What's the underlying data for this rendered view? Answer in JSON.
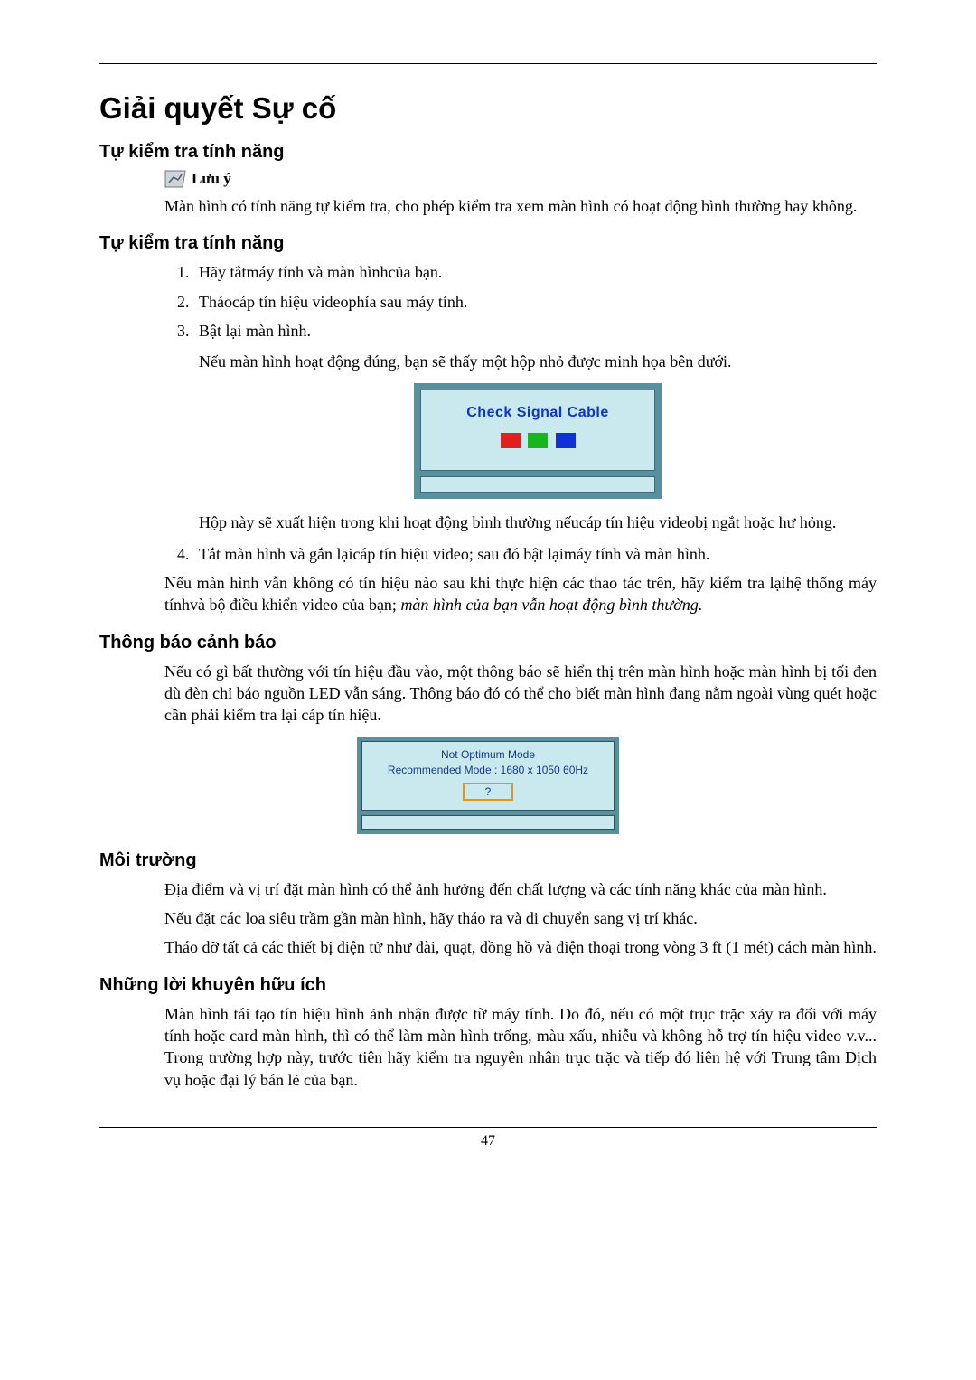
{
  "page_title": "Giải quyết Sự cố",
  "sections": {
    "s1_heading": "Tự kiểm tra tính năng",
    "note_label": "Lưu ý",
    "s1_body": "Màn hình có tính năng tự kiểm tra, cho phép kiểm tra xem màn hình có hoạt động bình thường hay không.",
    "s2_heading": "Tự kiểm tra tính năng",
    "steps": {
      "i1": "Hãy tắtmáy tính và màn hìnhcủa bạn.",
      "i2": "Tháocáp tín hiệu videophía sau máy tính.",
      "i3": "Bật lại màn hình.",
      "i3_sub": "Nếu màn hình hoạt động đúng, bạn sẽ thấy một hộp nhỏ được minh họa bên dưới.",
      "i3_sub2": "Hộp này sẽ xuất hiện trong khi hoạt động bình thường nếucáp tín hiệu videobị ngắt hoặc hư hỏng.",
      "i4": "Tắt màn hình và gắn lạicáp tín hiệu video; sau đó bật lạimáy tính và màn hình."
    },
    "s2_body_after_a": "Nếu màn hình vẫn không có tín hiệu nào sau khi thực hiện các thao tác trên, hãy kiểm tra lạihệ thống máy tínhvà bộ điều khiển video của bạn; ",
    "s2_body_after_italic": "màn hình của bạn vẫn hoạt động bình thường.",
    "s3_heading": "Thông báo cảnh báo",
    "s3_body": "Nếu có gì bất thường với tín hiệu đầu vào, một thông báo sẽ hiển thị trên màn hình hoặc màn hình bị tối đen dù đèn chỉ báo nguồn LED vẫn sáng. Thông báo đó có thể cho biết màn hình đang nằm ngoài vùng quét hoặc cần phải kiểm tra lại cáp tín hiệu.",
    "s4_heading": "Môi trường",
    "s4_p1": "Địa điểm và vị trí đặt màn hình có thể ảnh hưởng đến chất lượng và các tính năng khác của màn hình.",
    "s4_p2": "Nếu đặt các loa siêu trầm gần màn hình, hãy tháo ra và di chuyển sang vị trí khác.",
    "s4_p3": "Tháo dỡ tất cả các thiết bị điện tử như đài, quạt, đồng hồ và điện thoại trong vòng 3 ft (1 mét) cách màn hình.",
    "s5_heading": "Những lời khuyên hữu ích",
    "s5_body": "Màn hình tái tạo tín hiệu hình ảnh nhận được từ máy tính. Do đó, nếu có một trục trặc xảy ra đối với máy tính hoặc card màn hình, thì có thể làm màn hình trống, màu xấu, nhiễu và không hỗ trợ tín hiệu video v.v... Trong trường hợp này, trước tiên hãy kiểm tra nguyên nhân trục trặc và tiếp đó liên hệ với Trung tâm Dịch vụ hoặc đại lý bán lẻ của bạn."
  },
  "figures": {
    "check_signal_text": "Check Signal Cable",
    "optimum_line1": "Not Optimum Mode",
    "optimum_line2": "Recommended Mode : 1680 x 1050 60Hz",
    "optimum_button": "?"
  },
  "page_number": "47"
}
